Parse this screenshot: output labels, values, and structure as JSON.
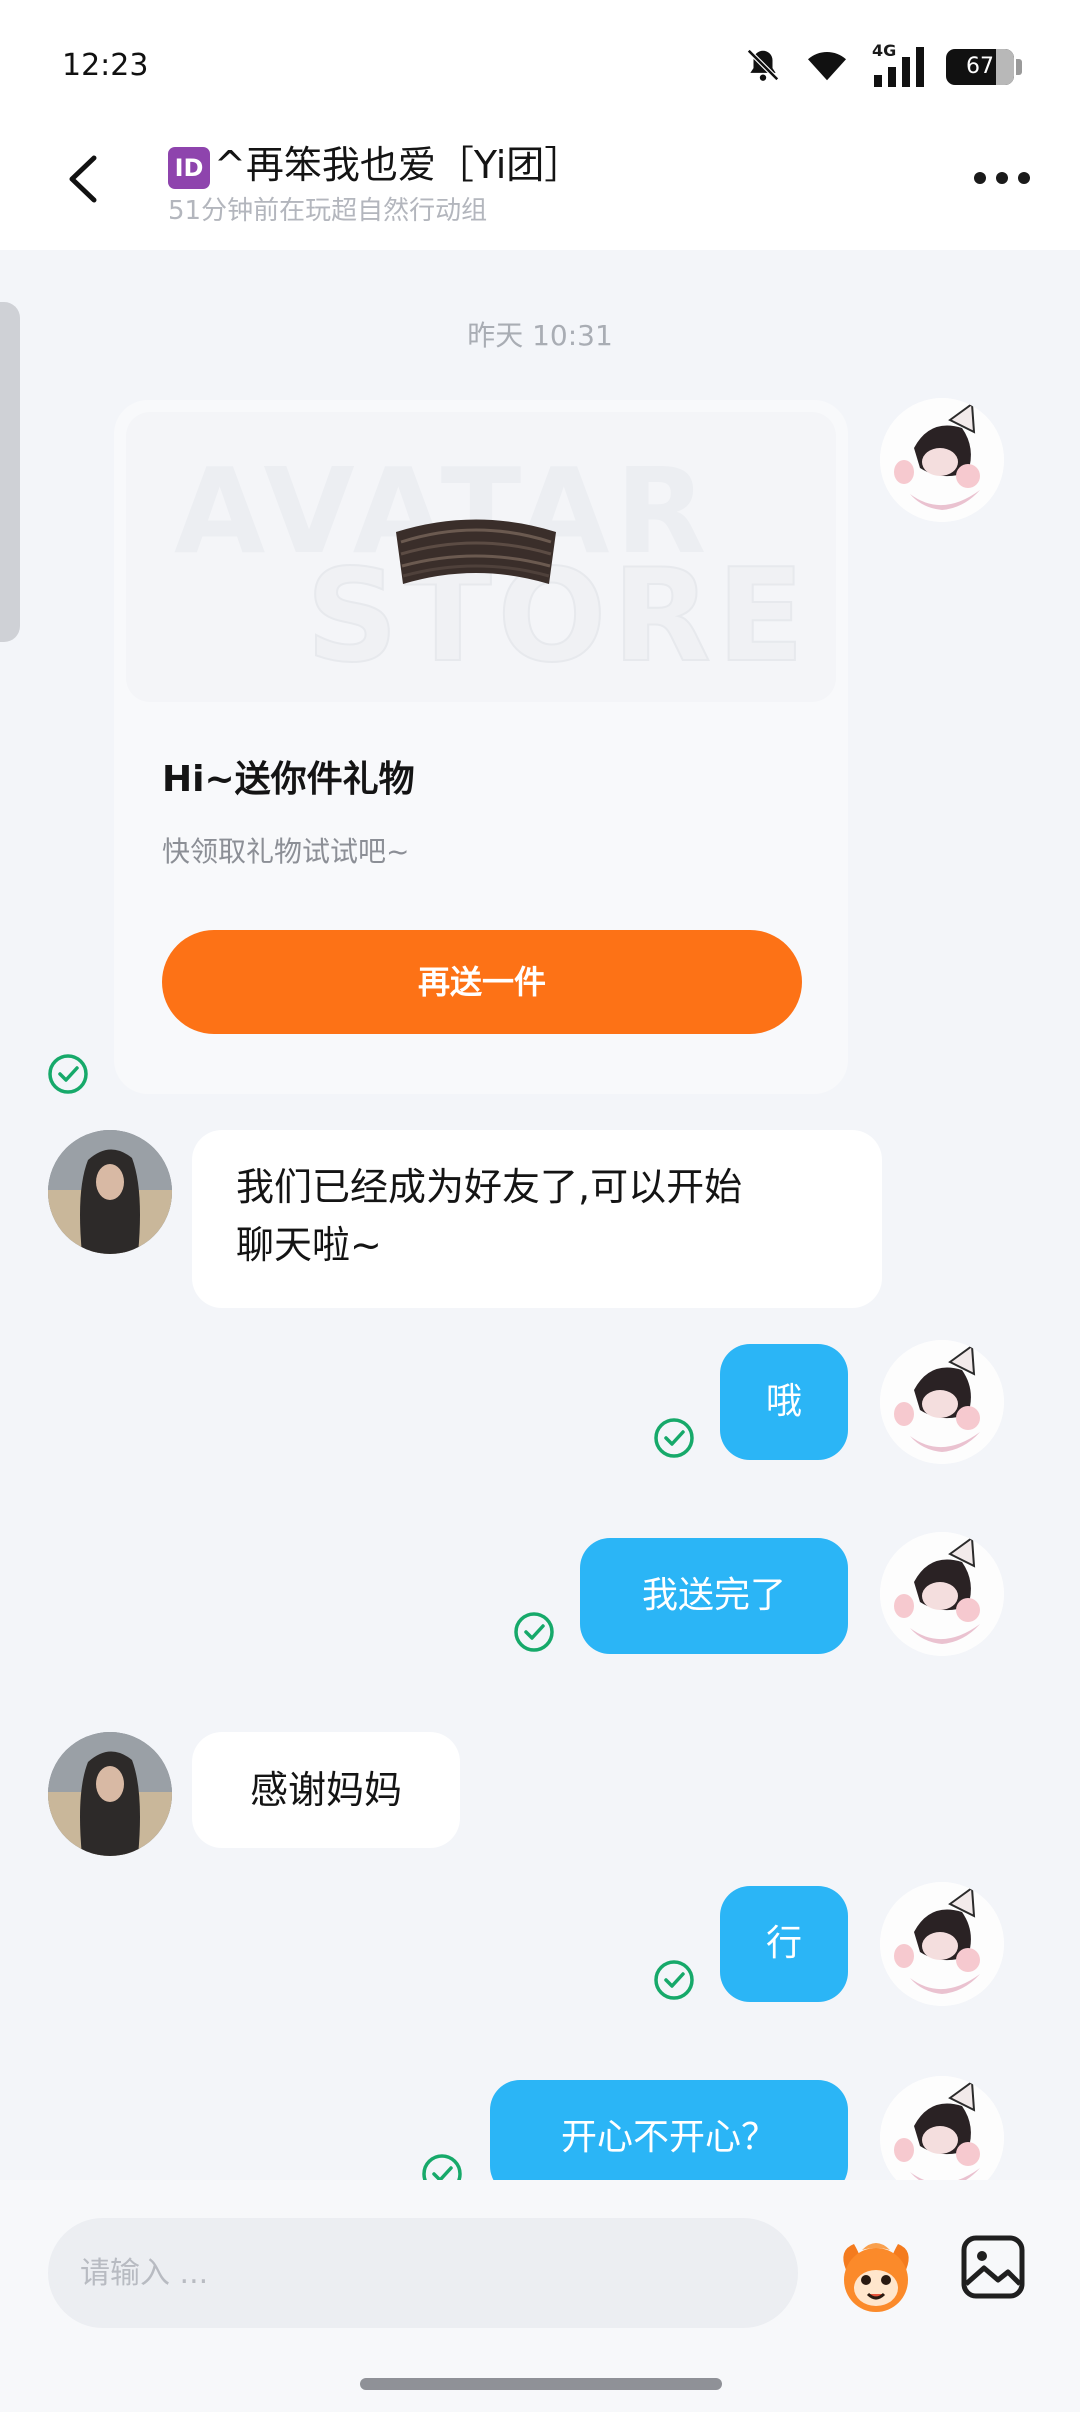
{
  "status_bar": {
    "time": "12:23",
    "network": "4G",
    "battery": "67"
  },
  "header": {
    "badge": "ID",
    "title": "^再笨我也爱［Yi团］",
    "subtitle": "51分钟前在玩超自然行动组"
  },
  "chat": {
    "timestamp": "昨天 10:31",
    "gift_card": {
      "watermark_top": "AVATAR",
      "watermark_bottom": "STORE",
      "title": "Hi~送你件礼物",
      "description": "快领取礼物试试吧~",
      "button_label": "再送一件"
    },
    "messages": [
      {
        "side": "in",
        "text_line1": "我们已经成为好友了,可以开始",
        "text_line2": "聊天啦~"
      },
      {
        "side": "out",
        "text": "哦",
        "read": true
      },
      {
        "side": "out",
        "text": "我送完了",
        "read": true
      },
      {
        "side": "in",
        "text": "感谢妈妈"
      },
      {
        "side": "out",
        "text": "行",
        "read": true
      },
      {
        "side": "out",
        "text": "开心不开心？",
        "read": true
      }
    ]
  },
  "input": {
    "placeholder": "请输入 ..."
  },
  "colors": {
    "accent_orange": "#fd7216",
    "bubble_blue": "#2bb5f6",
    "read_check": "#16a96a",
    "id_badge": "#8e44ad"
  },
  "icons": {
    "back": "back-arrow-icon",
    "more": "more-dots-icon",
    "mute": "bell-muted-icon",
    "wifi": "wifi-icon",
    "signal": "signal-icon",
    "check": "check-circle-icon",
    "mascot": "mascot-emoji-icon",
    "image": "image-picker-icon"
  }
}
